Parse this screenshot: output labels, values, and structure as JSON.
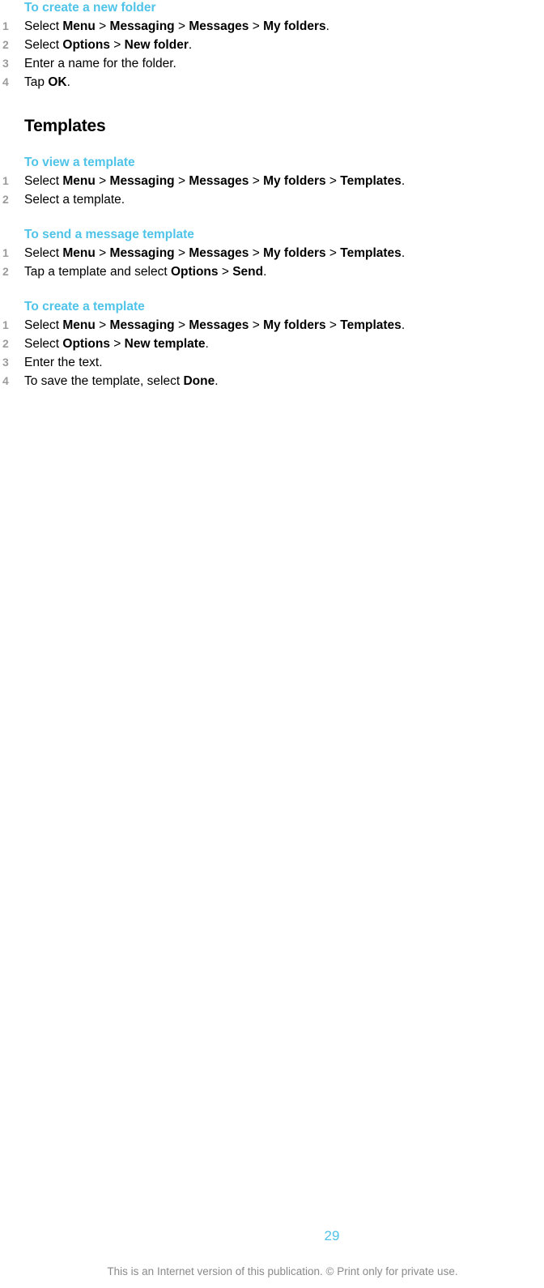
{
  "document": {
    "page_number": "29",
    "footer_note": "This is an Internet version of this publication. © Print only for private use.",
    "accent_color": "#4fc3e8",
    "number_color": "#9b9b9b",
    "footer_color": "#8a8a8a"
  },
  "sections": [
    {
      "id": "create-new-folder",
      "heading": "To create a new folder",
      "heading_type": "procedure",
      "steps": [
        {
          "num": "1",
          "parts": [
            {
              "text": "Select ",
              "bold": false
            },
            {
              "text": "Menu",
              "bold": true
            },
            {
              "text": " > ",
              "bold": false
            },
            {
              "text": "Messaging",
              "bold": true
            },
            {
              "text": " > ",
              "bold": false
            },
            {
              "text": "Messages",
              "bold": true
            },
            {
              "text": " > ",
              "bold": false
            },
            {
              "text": "My folders",
              "bold": true
            },
            {
              "text": ".",
              "bold": false
            }
          ]
        },
        {
          "num": "2",
          "parts": [
            {
              "text": "Select ",
              "bold": false
            },
            {
              "text": "Options",
              "bold": true
            },
            {
              "text": " > ",
              "bold": false
            },
            {
              "text": "New folder",
              "bold": true
            },
            {
              "text": ".",
              "bold": false
            }
          ]
        },
        {
          "num": "3",
          "parts": [
            {
              "text": "Enter a name for the folder.",
              "bold": false
            }
          ]
        },
        {
          "num": "4",
          "parts": [
            {
              "text": "Tap ",
              "bold": false
            },
            {
              "text": "OK",
              "bold": true
            },
            {
              "text": ".",
              "bold": false
            }
          ]
        }
      ]
    },
    {
      "id": "templates",
      "heading": "Templates",
      "heading_type": "section",
      "steps": []
    },
    {
      "id": "view-a-template",
      "heading": "To view a template",
      "heading_type": "procedure",
      "steps": [
        {
          "num": "1",
          "parts": [
            {
              "text": "Select ",
              "bold": false
            },
            {
              "text": "Menu",
              "bold": true
            },
            {
              "text": " > ",
              "bold": false
            },
            {
              "text": "Messaging",
              "bold": true
            },
            {
              "text": " > ",
              "bold": false
            },
            {
              "text": "Messages",
              "bold": true
            },
            {
              "text": " > ",
              "bold": false
            },
            {
              "text": "My folders",
              "bold": true
            },
            {
              "text": " > ",
              "bold": false
            },
            {
              "text": "Templates",
              "bold": true
            },
            {
              "text": ".",
              "bold": false
            }
          ]
        },
        {
          "num": "2",
          "parts": [
            {
              "text": "Select a template.",
              "bold": false
            }
          ]
        }
      ]
    },
    {
      "id": "send-a-message-template",
      "heading": "To send a message template",
      "heading_type": "procedure",
      "steps": [
        {
          "num": "1",
          "parts": [
            {
              "text": "Select ",
              "bold": false
            },
            {
              "text": "Menu",
              "bold": true
            },
            {
              "text": " > ",
              "bold": false
            },
            {
              "text": "Messaging",
              "bold": true
            },
            {
              "text": " > ",
              "bold": false
            },
            {
              "text": "Messages",
              "bold": true
            },
            {
              "text": " > ",
              "bold": false
            },
            {
              "text": "My folders",
              "bold": true
            },
            {
              "text": " > ",
              "bold": false
            },
            {
              "text": "Templates",
              "bold": true
            },
            {
              "text": ".",
              "bold": false
            }
          ]
        },
        {
          "num": "2",
          "parts": [
            {
              "text": "Tap a template and select ",
              "bold": false
            },
            {
              "text": "Options",
              "bold": true
            },
            {
              "text": " > ",
              "bold": false
            },
            {
              "text": "Send",
              "bold": true
            },
            {
              "text": ".",
              "bold": false
            }
          ]
        }
      ]
    },
    {
      "id": "create-a-template",
      "heading": "To create a template",
      "heading_type": "procedure",
      "steps": [
        {
          "num": "1",
          "parts": [
            {
              "text": "Select ",
              "bold": false
            },
            {
              "text": "Menu",
              "bold": true
            },
            {
              "text": " > ",
              "bold": false
            },
            {
              "text": "Messaging",
              "bold": true
            },
            {
              "text": " > ",
              "bold": false
            },
            {
              "text": "Messages",
              "bold": true
            },
            {
              "text": " > ",
              "bold": false
            },
            {
              "text": "My folders",
              "bold": true
            },
            {
              "text": " > ",
              "bold": false
            },
            {
              "text": "Templates",
              "bold": true
            },
            {
              "text": ".",
              "bold": false
            }
          ]
        },
        {
          "num": "2",
          "parts": [
            {
              "text": "Select ",
              "bold": false
            },
            {
              "text": "Options",
              "bold": true
            },
            {
              "text": " > ",
              "bold": false
            },
            {
              "text": "New template",
              "bold": true
            },
            {
              "text": ".",
              "bold": false
            }
          ]
        },
        {
          "num": "3",
          "parts": [
            {
              "text": "Enter the text.",
              "bold": false
            }
          ]
        },
        {
          "num": "4",
          "parts": [
            {
              "text": "To save the template, select ",
              "bold": false
            },
            {
              "text": "Done",
              "bold": true
            },
            {
              "text": ".",
              "bold": false
            }
          ]
        }
      ]
    }
  ]
}
